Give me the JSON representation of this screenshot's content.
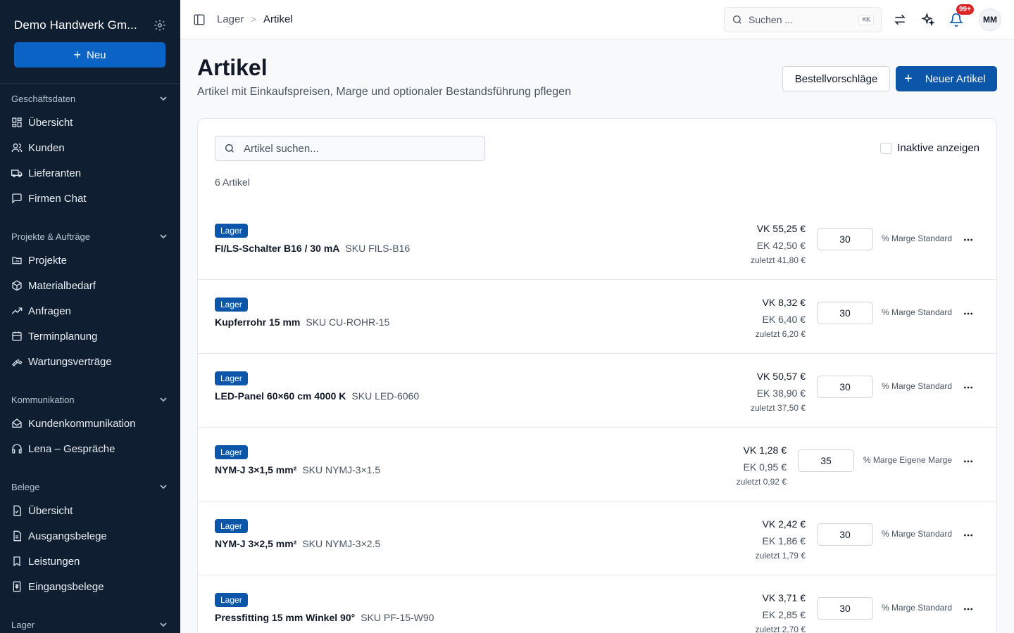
{
  "sidebar": {
    "company": "Demo Handwerk Gm...",
    "new_label": "Neu",
    "sections": [
      {
        "title": "Geschäftsdaten",
        "items": [
          "Übersicht",
          "Kunden",
          "Lieferanten",
          "Firmen Chat"
        ]
      },
      {
        "title": "Projekte & Aufträge",
        "items": [
          "Projekte",
          "Materialbedarf",
          "Anfragen",
          "Terminplanung",
          "Wartungsverträge"
        ]
      },
      {
        "title": "Kommunikation",
        "items": [
          "Kundenkommunikation",
          "Lena – Gespräche"
        ]
      },
      {
        "title": "Belege",
        "items": [
          "Übersicht",
          "Ausgangsbelege",
          "Leistungen",
          "Eingangsbelege"
        ]
      },
      {
        "title": "Lager",
        "items": []
      }
    ]
  },
  "topbar": {
    "breadcrumb": [
      "Lager",
      "Artikel"
    ],
    "search_placeholder": "Suchen ...",
    "shortcut": "⌘K",
    "notifications": "99+",
    "avatar": "MM"
  },
  "header": {
    "title": "Artikel",
    "subtitle": "Artikel mit Einkaufspreisen, Marge und optionaler Bestandsführung pflegen",
    "btn_suggestions": "Bestellvorschläge",
    "btn_new": "Neuer Artikel"
  },
  "list": {
    "search_placeholder": "Artikel suchen...",
    "inactive_label": "Inaktive anzeigen",
    "count": "6 Artikel",
    "rows": [
      {
        "tag": "Lager",
        "name": "FI/LS-Schalter B16 / 30 mA",
        "sku": "SKU FILS-B16",
        "vk": "VK 55,25 €",
        "ek": "EK 42,50 €",
        "last": "zuletzt 41,80 €",
        "marge": "30",
        "marge_label": "% Marge Standard"
      },
      {
        "tag": "Lager",
        "name": "Kupferrohr 15 mm",
        "sku": "SKU CU-ROHR-15",
        "vk": "VK 8,32 €",
        "ek": "EK 6,40 €",
        "last": "zuletzt 6,20 €",
        "marge": "30",
        "marge_label": "% Marge Standard"
      },
      {
        "tag": "Lager",
        "name": "LED-Panel 60×60 cm 4000 K",
        "sku": "SKU LED-6060",
        "vk": "VK 50,57 €",
        "ek": "EK 38,90 €",
        "last": "zuletzt 37,50 €",
        "marge": "30",
        "marge_label": "% Marge Standard"
      },
      {
        "tag": "Lager",
        "name": "NYM-J 3×1,5 mm²",
        "sku": "SKU NYMJ-3×1.5",
        "vk": "VK 1,28 €",
        "ek": "EK 0,95 €",
        "last": "zuletzt 0,92 €",
        "marge": "35",
        "marge_label": "% Marge Eigene Marge"
      },
      {
        "tag": "Lager",
        "name": "NYM-J 3×2,5 mm²",
        "sku": "SKU NYMJ-3×2.5",
        "vk": "VK 2,42 €",
        "ek": "EK 1,86 €",
        "last": "zuletzt 1,79 €",
        "marge": "30",
        "marge_label": "% Marge Standard"
      },
      {
        "tag": "Lager",
        "name": "Pressfitting 15 mm Winkel 90°",
        "sku": "SKU PF-15-W90",
        "vk": "VK 3,71 €",
        "ek": "EK 2,85 €",
        "last": "zuletzt 2,70 €",
        "marge": "30",
        "marge_label": "% Marge Standard"
      }
    ]
  }
}
